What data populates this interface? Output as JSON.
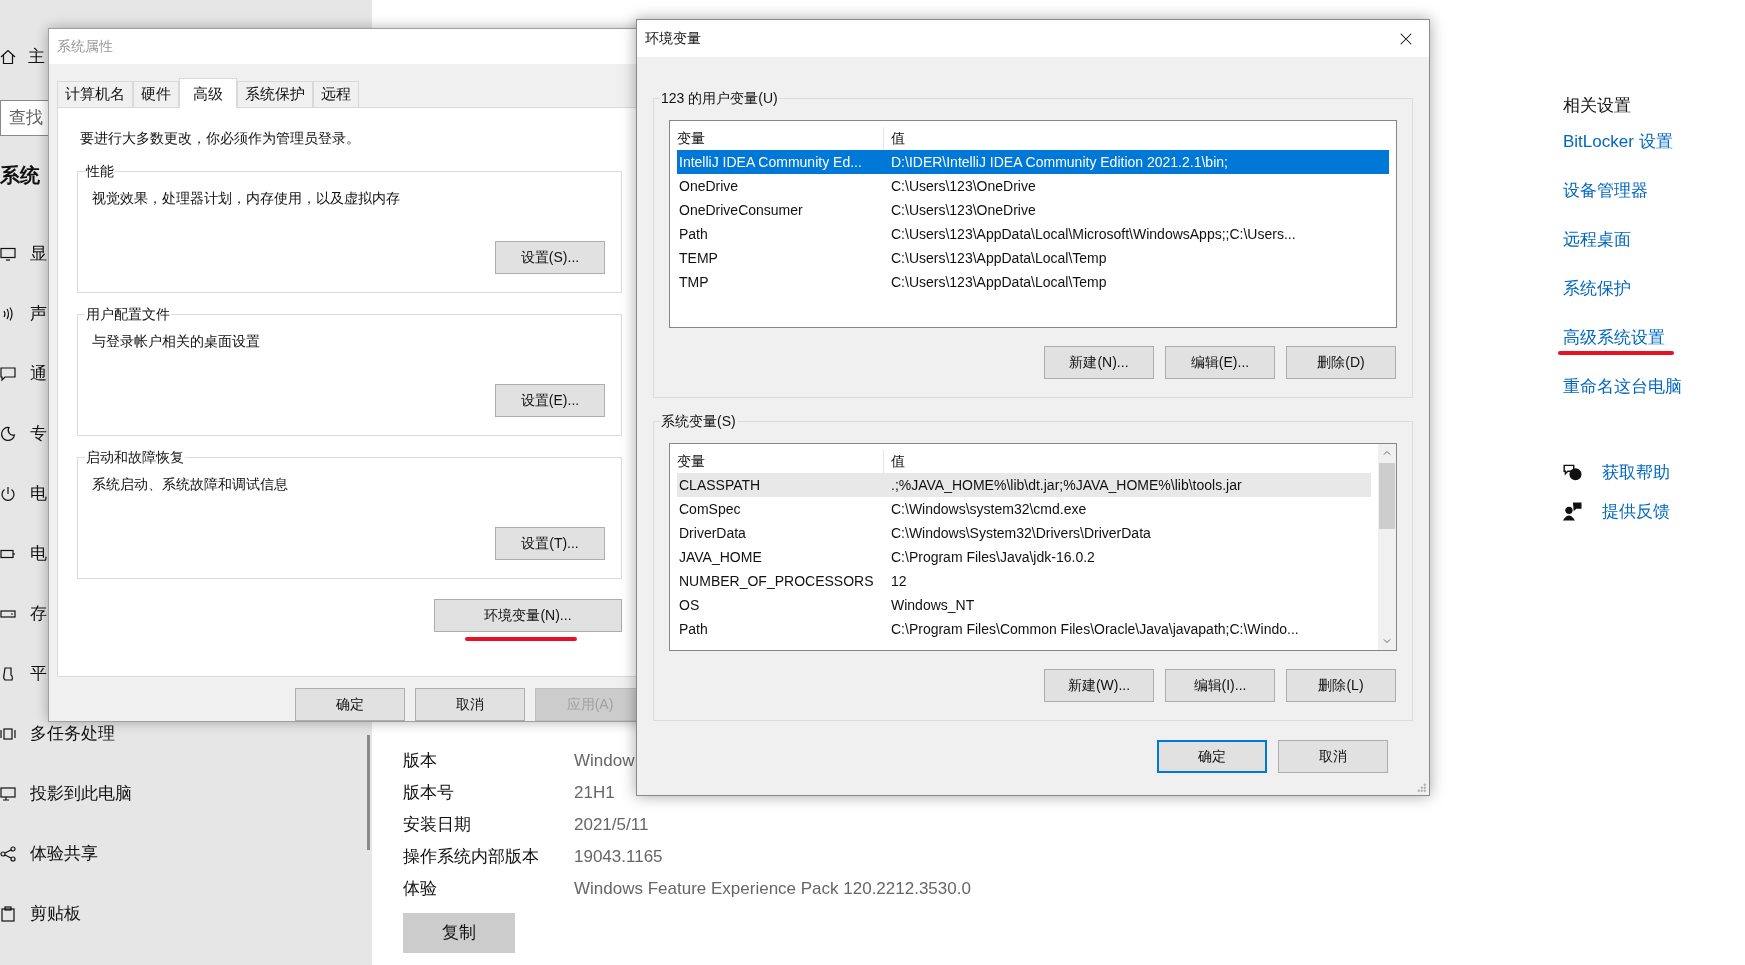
{
  "settings_nav": {
    "home": "主",
    "search_placeholder": "查找",
    "title": "系统",
    "items": [
      {
        "label": "显"
      },
      {
        "label": "声"
      },
      {
        "label": "通"
      },
      {
        "label": "专"
      },
      {
        "label": "电"
      },
      {
        "label": "电"
      },
      {
        "label": "存"
      },
      {
        "label": "平"
      },
      {
        "label": "多任务处理"
      },
      {
        "label": "投影到此电脑"
      },
      {
        "label": "体验共享"
      },
      {
        "label": "剪贴板"
      }
    ]
  },
  "about": {
    "rows": [
      {
        "label": "版本",
        "value": "Window"
      },
      {
        "label": "版本号",
        "value": "21H1"
      },
      {
        "label": "安装日期",
        "value": "2021/5/11"
      },
      {
        "label": "操作系统内部版本",
        "value": "19043.1165"
      },
      {
        "label": "体验",
        "value": "Windows Feature Experience Pack 120.2212.3530.0"
      }
    ],
    "copy_button": "复制"
  },
  "related_settings": {
    "title": "相关设置",
    "links": [
      {
        "label": "BitLocker 设置",
        "underlined": false
      },
      {
        "label": "设备管理器",
        "underlined": false
      },
      {
        "label": "远程桌面",
        "underlined": false
      },
      {
        "label": "系统保护",
        "underlined": false
      },
      {
        "label": "高级系统设置",
        "underlined": true
      },
      {
        "label": "重命名这台电脑",
        "underlined": false
      }
    ]
  },
  "help_links": [
    {
      "label": "获取帮助"
    },
    {
      "label": "提供反馈"
    }
  ],
  "system_properties": {
    "title": "系统属性",
    "tabs": [
      {
        "label": "计算机名",
        "selected": false
      },
      {
        "label": "硬件",
        "selected": false
      },
      {
        "label": "高级",
        "selected": true
      },
      {
        "label": "系统保护",
        "selected": false
      },
      {
        "label": "远程",
        "selected": false
      }
    ],
    "notice": "要进行大多数更改，你必须作为管理员登录。",
    "groups": [
      {
        "title": "性能",
        "description": "视觉效果，处理器计划，内存使用，以及虚拟内存",
        "button": "设置(S)..."
      },
      {
        "title": "用户配置文件",
        "description": "与登录帐户相关的桌面设置",
        "button": "设置(E)..."
      },
      {
        "title": "启动和故障恢复",
        "description": "系统启动、系统故障和调试信息",
        "button": "设置(T)..."
      }
    ],
    "env_button": {
      "label": "环境变量(N)...",
      "underlined": true
    },
    "buttons": [
      {
        "label": "确定",
        "disabled": false
      },
      {
        "label": "取消",
        "disabled": false
      },
      {
        "label": "应用(A)",
        "disabled": true
      }
    ]
  },
  "environment_variables": {
    "title": "环境变量",
    "user_vars": {
      "title": "123 的用户变量(U)",
      "columns": [
        "变量",
        "值"
      ],
      "rows": [
        {
          "name": "IntelliJ IDEA Community Ed...",
          "value": "D:\\IDER\\IntelliJ IDEA Community Edition 2021.2.1\\bin;",
          "selected": true
        },
        {
          "name": "OneDrive",
          "value": "C:\\Users\\123\\OneDrive",
          "selected": false
        },
        {
          "name": "OneDriveConsumer",
          "value": "C:\\Users\\123\\OneDrive",
          "selected": false
        },
        {
          "name": "Path",
          "value": "C:\\Users\\123\\AppData\\Local\\Microsoft\\WindowsApps;;C:\\Users...",
          "selected": false
        },
        {
          "name": "TEMP",
          "value": "C:\\Users\\123\\AppData\\Local\\Temp",
          "selected": false
        },
        {
          "name": "TMP",
          "value": "C:\\Users\\123\\AppData\\Local\\Temp",
          "selected": false
        }
      ],
      "buttons": [
        "新建(N)...",
        "编辑(E)...",
        "删除(D)"
      ]
    },
    "system_vars": {
      "title": "系统变量(S)",
      "columns": [
        "变量",
        "值"
      ],
      "rows": [
        {
          "name": "CLASSPATH",
          "value": ".;%JAVA_HOME%\\lib\\dt.jar;%JAVA_HOME%\\lib\\tools.jar",
          "selected": true
        },
        {
          "name": "ComSpec",
          "value": "C:\\Windows\\system32\\cmd.exe",
          "selected": false
        },
        {
          "name": "DriverData",
          "value": "C:\\Windows\\System32\\Drivers\\DriverData",
          "selected": false
        },
        {
          "name": "JAVA_HOME",
          "value": "C:\\Program Files\\Java\\jdk-16.0.2",
          "selected": false
        },
        {
          "name": "NUMBER_OF_PROCESSORS",
          "value": "12",
          "selected": false
        },
        {
          "name": "OS",
          "value": "Windows_NT",
          "selected": false
        },
        {
          "name": "Path",
          "value": "C:\\Program Files\\Common Files\\Oracle\\Java\\javapath;C:\\Windo...",
          "selected": false
        }
      ],
      "buttons": [
        "新建(W)...",
        "编辑(I)...",
        "删除(L)"
      ]
    },
    "buttons": [
      {
        "label": "确定",
        "default": true
      },
      {
        "label": "取消",
        "default": false
      }
    ]
  }
}
